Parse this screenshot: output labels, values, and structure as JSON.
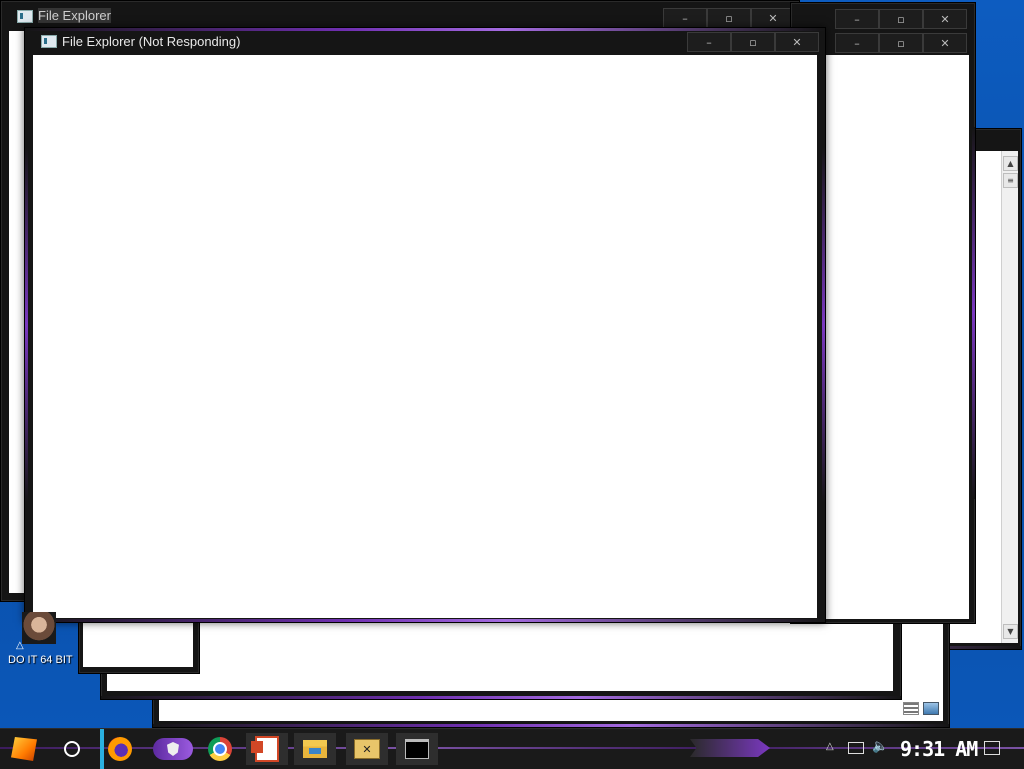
{
  "background_window": {
    "title": "File Explorer"
  },
  "active_window": {
    "title": "File Explorer (Not Responding)"
  },
  "window_controls": {
    "minimize": "–",
    "maximize": "▫",
    "close": "✕"
  },
  "desktop_icon": {
    "label": "DO IT 64 BIT"
  },
  "taskbar": {
    "clock": "9:31 AM",
    "apps": [
      "start-icon",
      "cortana-circle-icon",
      "firefox-icon",
      "purple-app-icon",
      "chrome-icon",
      "powerpoint-icon",
      "file-explorer-icon",
      "xd-icon",
      "command-prompt-icon"
    ]
  },
  "colors": {
    "accent": "#7a38c0",
    "desktop": "#0b4fa8",
    "window_frame": "#151515",
    "taskbar": "#1a1a1a"
  }
}
